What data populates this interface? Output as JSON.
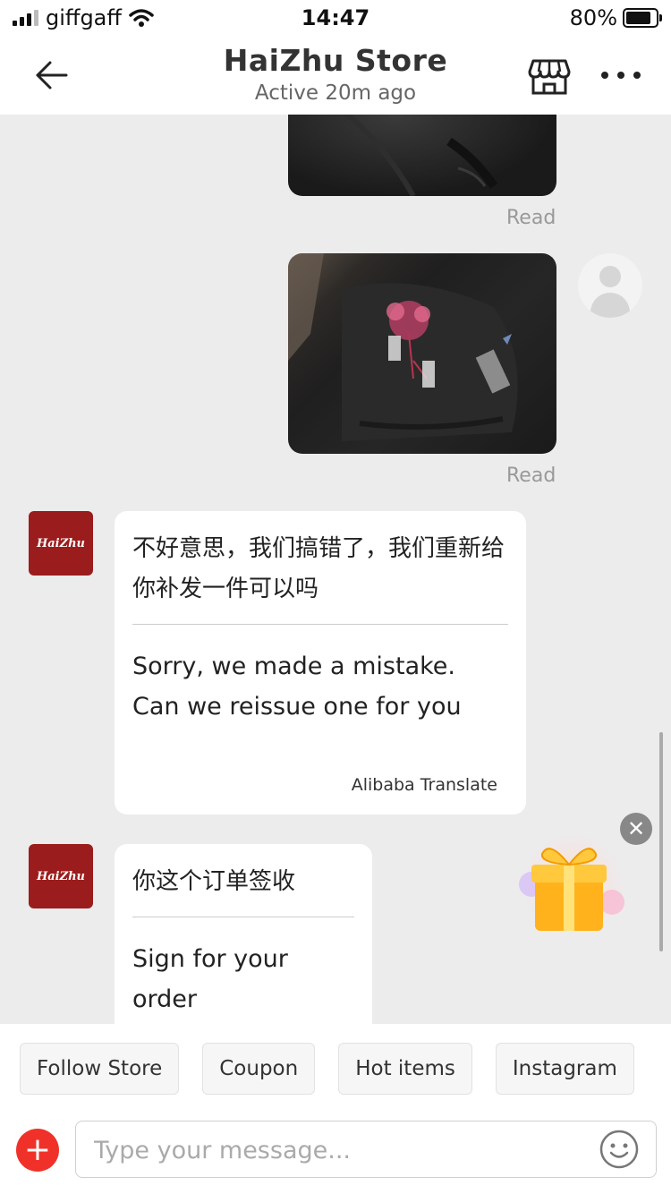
{
  "status_bar": {
    "carrier": "giffgaff",
    "time": "14:47",
    "battery": "80%",
    "battery_level": 0.8
  },
  "header": {
    "store_name": "HaiZhu Store",
    "status": "Active 20m ago",
    "icons": [
      "back-arrow-icon",
      "store-icon",
      "more-options-icon"
    ]
  },
  "messages": [
    {
      "type": "image",
      "sender": "user",
      "status": "Read"
    },
    {
      "type": "image",
      "sender": "user",
      "status": "Read"
    },
    {
      "type": "text",
      "sender": "store",
      "original": "不好意思，我们搞错了，我们重新给你补发一件可以吗",
      "translated": "Sorry, we made a mistake. Can we reissue one for you",
      "translated_by": "Alibaba Translate"
    },
    {
      "type": "text",
      "sender": "store",
      "original": "你这个订单签收",
      "translated": "Sign for your order"
    }
  ],
  "store_avatar_text": "HaiZhu",
  "quick_replies": [
    "Follow Store",
    "Coupon",
    "Hot items",
    "Instagram"
  ],
  "composer": {
    "placeholder": "Type your message..."
  },
  "colors": {
    "brand_red": "#f0312a",
    "store_avatar": "#9b1c1c",
    "chat_background": "#ececec"
  }
}
